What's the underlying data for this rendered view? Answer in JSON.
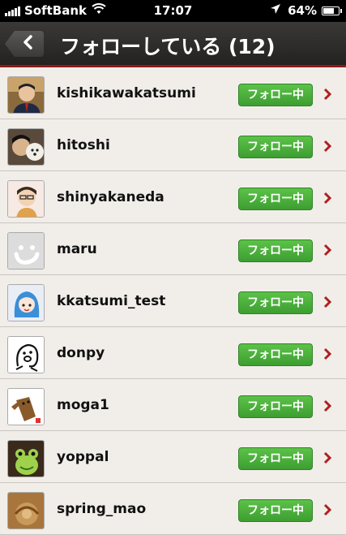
{
  "status_bar": {
    "carrier": "SoftBank",
    "time": "17:07",
    "battery": "64%",
    "battery_level": 0.64,
    "icons": [
      "signal-bars-icon",
      "wifi-icon",
      "location-arrow-icon",
      "battery-icon"
    ]
  },
  "nav": {
    "back_icon": "chevron-left-icon",
    "title": "フォローしている (12)"
  },
  "colors": {
    "follow_button": "#4cb23e",
    "accent_red": "#b11f1f",
    "navbar": "#2d2c2a"
  },
  "following": [
    {
      "username": "kishikawakatsumi",
      "button": "フォロー中"
    },
    {
      "username": "hitoshi",
      "button": "フォロー中"
    },
    {
      "username": "shinyakaneda",
      "button": "フォロー中"
    },
    {
      "username": "maru",
      "button": "フォロー中"
    },
    {
      "username": "kkatsumi_test",
      "button": "フォロー中"
    },
    {
      "username": "donpy",
      "button": "フォロー中"
    },
    {
      "username": "moga1",
      "button": "フォロー中"
    },
    {
      "username": "yoppal",
      "button": "フォロー中"
    },
    {
      "username": "spring_mao",
      "button": "フォロー中"
    }
  ]
}
